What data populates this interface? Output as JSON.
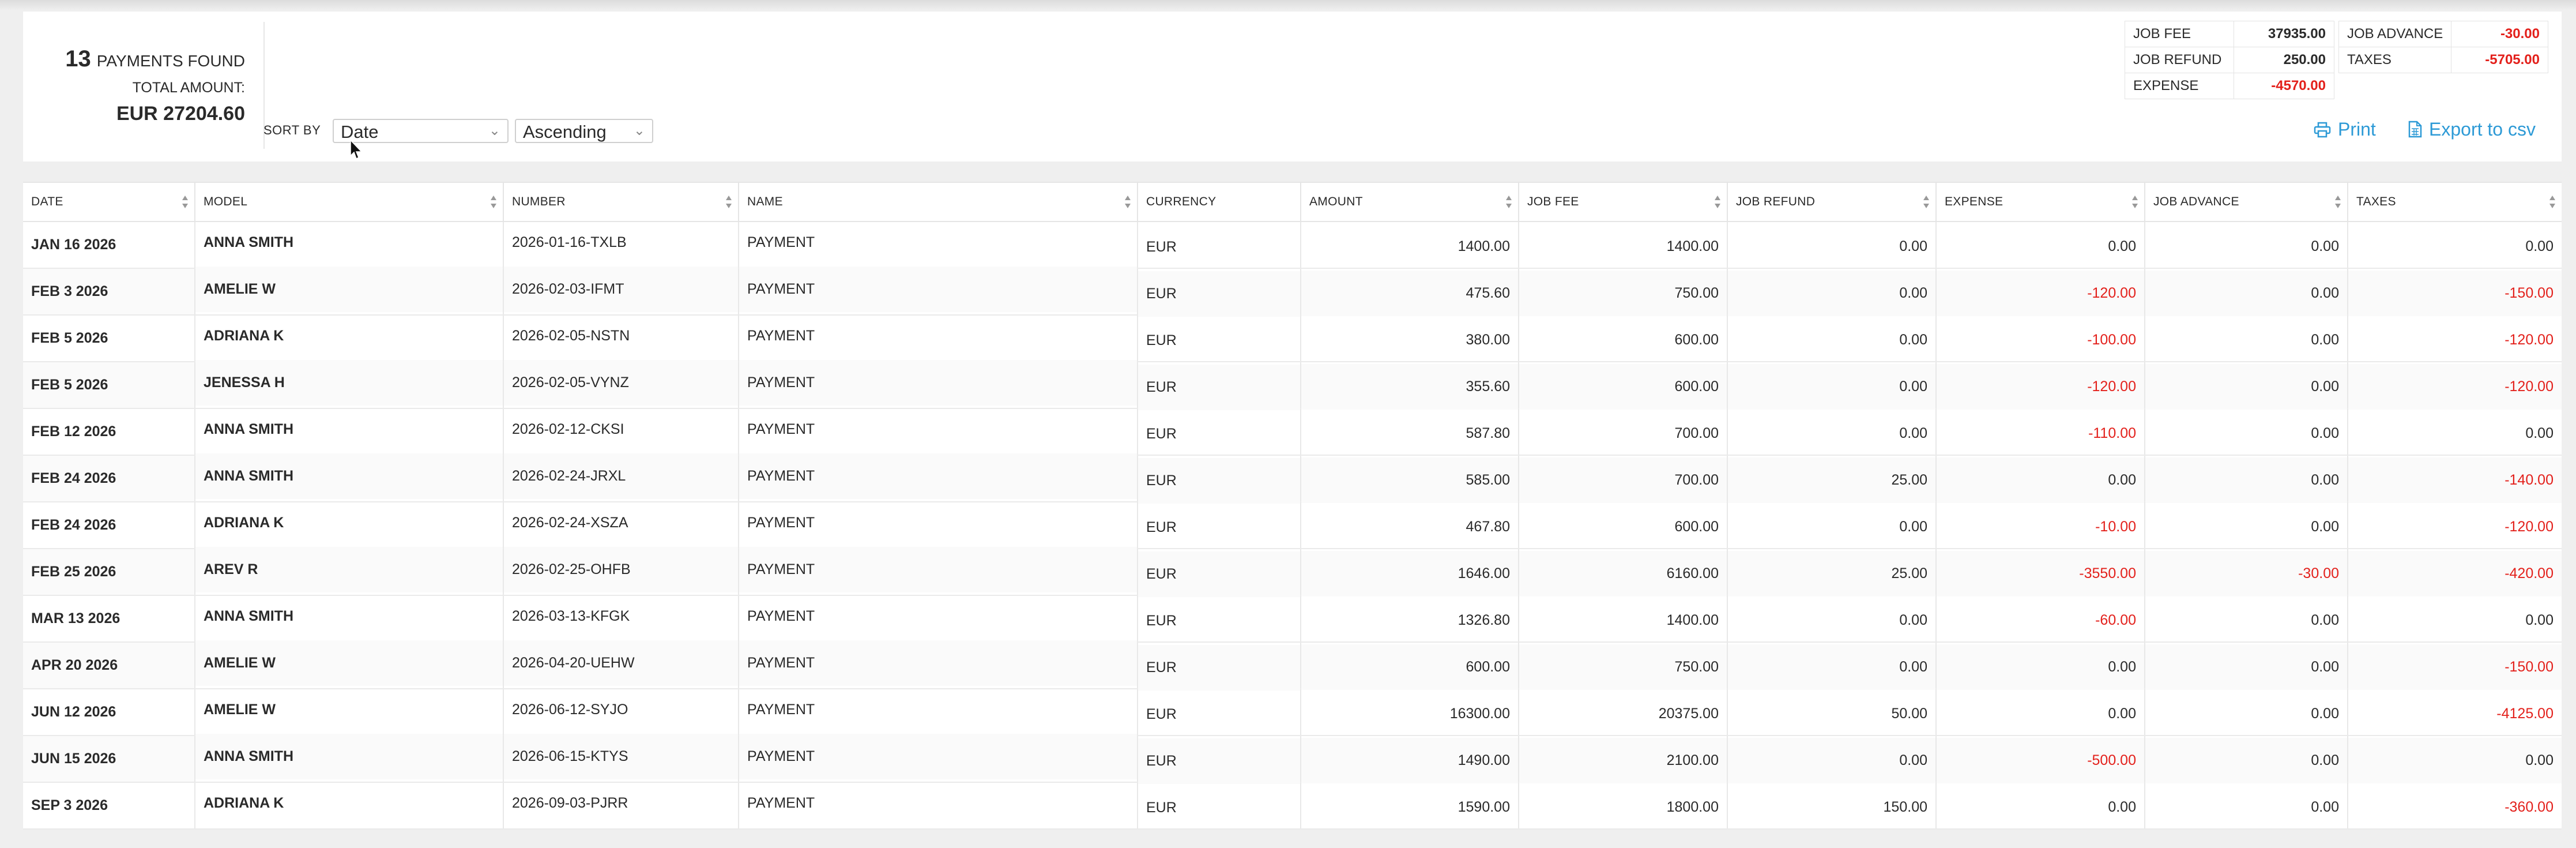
{
  "summary": {
    "count": "13",
    "count_label": "PAYMENTS FOUND",
    "total_label": "TOTAL AMOUNT:",
    "total_value": "EUR 27204.60"
  },
  "sort": {
    "label": "SORT BY",
    "field": "Date",
    "order": "Ascending"
  },
  "totals": {
    "job_fee": {
      "label": "JOB FEE",
      "value": "37935.00"
    },
    "job_refund": {
      "label": "JOB REFUND",
      "value": "250.00"
    },
    "expense": {
      "label": "EXPENSE",
      "value": "-4570.00"
    },
    "job_advance": {
      "label": "JOB ADVANCE",
      "value": "-30.00"
    },
    "taxes": {
      "label": "TAXES",
      "value": "-5705.00"
    }
  },
  "actions": {
    "print": "Print",
    "export": "Export to csv"
  },
  "colors": {
    "accent": "#2d9ad6",
    "negative": "#e3201b"
  },
  "columns": [
    "DATE",
    "MODEL",
    "NUMBER",
    "NAME",
    "CURRENCY",
    "AMOUNT",
    "JOB FEE",
    "JOB REFUND",
    "EXPENSE",
    "JOB ADVANCE",
    "TAXES"
  ],
  "rows": [
    [
      "JAN 16 2026",
      "ANNA SMITH",
      "2026-01-16-TXLB",
      "PAYMENT",
      "EUR",
      "1400.00",
      "1400.00",
      "0.00",
      "0.00",
      "0.00",
      "0.00"
    ],
    [
      "FEB 3 2026",
      "AMELIE W",
      "2026-02-03-IFMT",
      "PAYMENT",
      "EUR",
      "475.60",
      "750.00",
      "0.00",
      "-120.00",
      "0.00",
      "-150.00"
    ],
    [
      "FEB 5 2026",
      "ADRIANA K",
      "2026-02-05-NSTN",
      "PAYMENT",
      "EUR",
      "380.00",
      "600.00",
      "0.00",
      "-100.00",
      "0.00",
      "-120.00"
    ],
    [
      "FEB 5 2026",
      "JENESSA H",
      "2026-02-05-VYNZ",
      "PAYMENT",
      "EUR",
      "355.60",
      "600.00",
      "0.00",
      "-120.00",
      "0.00",
      "-120.00"
    ],
    [
      "FEB 12 2026",
      "ANNA SMITH",
      "2026-02-12-CKSI",
      "PAYMENT",
      "EUR",
      "587.80",
      "700.00",
      "0.00",
      "-110.00",
      "0.00",
      "0.00"
    ],
    [
      "FEB 24 2026",
      "ANNA SMITH",
      "2026-02-24-JRXL",
      "PAYMENT",
      "EUR",
      "585.00",
      "700.00",
      "25.00",
      "0.00",
      "0.00",
      "-140.00"
    ],
    [
      "FEB 24 2026",
      "ADRIANA K",
      "2026-02-24-XSZA",
      "PAYMENT",
      "EUR",
      "467.80",
      "600.00",
      "0.00",
      "-10.00",
      "0.00",
      "-120.00"
    ],
    [
      "FEB 25 2026",
      "AREV R",
      "2026-02-25-OHFB",
      "PAYMENT",
      "EUR",
      "1646.00",
      "6160.00",
      "25.00",
      "-3550.00",
      "-30.00",
      "-420.00"
    ],
    [
      "MAR 13 2026",
      "ANNA SMITH",
      "2026-03-13-KFGK",
      "PAYMENT",
      "EUR",
      "1326.80",
      "1400.00",
      "0.00",
      "-60.00",
      "0.00",
      "0.00"
    ],
    [
      "APR 20 2026",
      "AMELIE W",
      "2026-04-20-UEHW",
      "PAYMENT",
      "EUR",
      "600.00",
      "750.00",
      "0.00",
      "0.00",
      "0.00",
      "-150.00"
    ],
    [
      "JUN 12 2026",
      "AMELIE W",
      "2026-06-12-SYJO",
      "PAYMENT",
      "EUR",
      "16300.00",
      "20375.00",
      "50.00",
      "0.00",
      "0.00",
      "-4125.00"
    ],
    [
      "JUN 15 2026",
      "ANNA SMITH",
      "2026-06-15-KTYS",
      "PAYMENT",
      "EUR",
      "1490.00",
      "2100.00",
      "0.00",
      "-500.00",
      "0.00",
      "0.00"
    ],
    [
      "SEP 3 2026",
      "ADRIANA K",
      "2026-09-03-PJRR",
      "PAYMENT",
      "EUR",
      "1590.00",
      "1800.00",
      "150.00",
      "0.00",
      "0.00",
      "-360.00"
    ]
  ]
}
